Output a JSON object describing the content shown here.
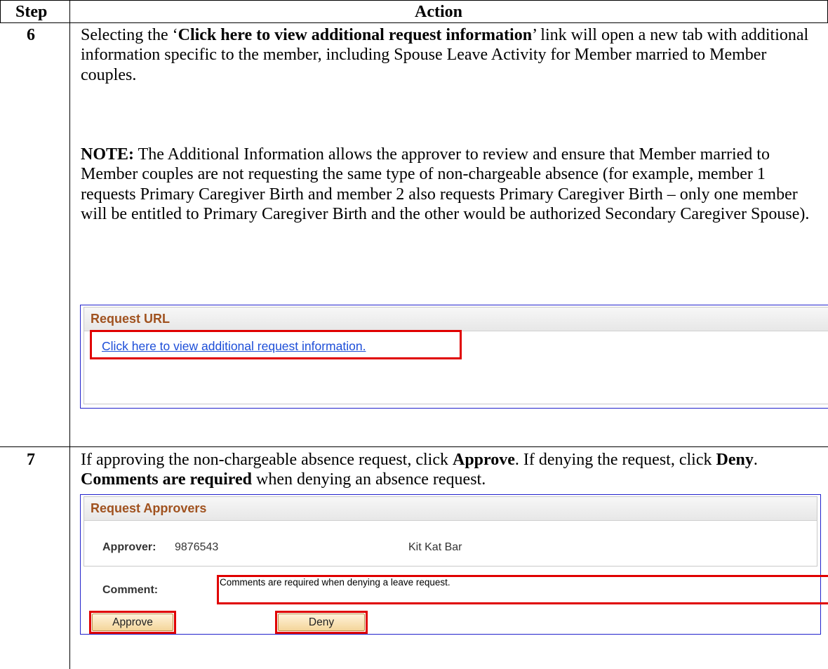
{
  "table": {
    "header_step": "Step",
    "header_action": "Action"
  },
  "step6": {
    "number": "6",
    "para1_pre": "Selecting the ‘",
    "para1_bold": "Click here to view additional request information",
    "para1_post": "’ link will open a new tab with additional information specific to the member, including Spouse Leave Activity for Member married to Member couples.",
    "note_label": "NOTE:",
    "note_text": "  The Additional Information allows the approver to review and ensure that Member married to Member couples are not requesting the same type of non-chargeable absence (for example, member 1 requests Primary Caregiver Birth and member 2 also requests Primary Caregiver Birth – only one member will be entitled to Primary Caregiver Birth and the other would be authorized Secondary Caregiver Spouse).",
    "panel": {
      "title": "Request URL",
      "link_text": "Click here to view additional request information."
    }
  },
  "step7": {
    "number": "7",
    "text_1": "If approving the non-chargeable absence request, click ",
    "approve_bold": "Approve",
    "text_2": ". If denying the request, click ",
    "deny_bold": "Deny",
    "text_3": ". ",
    "comments_bold": "Comments are required",
    "text_4": " when denying an absence request.",
    "panel": {
      "title": "Request Approvers",
      "approver_label": "Approver:",
      "approver_id": "9876543",
      "approver_name": "Kit Kat Bar",
      "comment_label": "Comment:",
      "comment_value": "Comments are required when denying a leave request.",
      "approve_button": "Approve",
      "deny_button": "Deny"
    }
  }
}
